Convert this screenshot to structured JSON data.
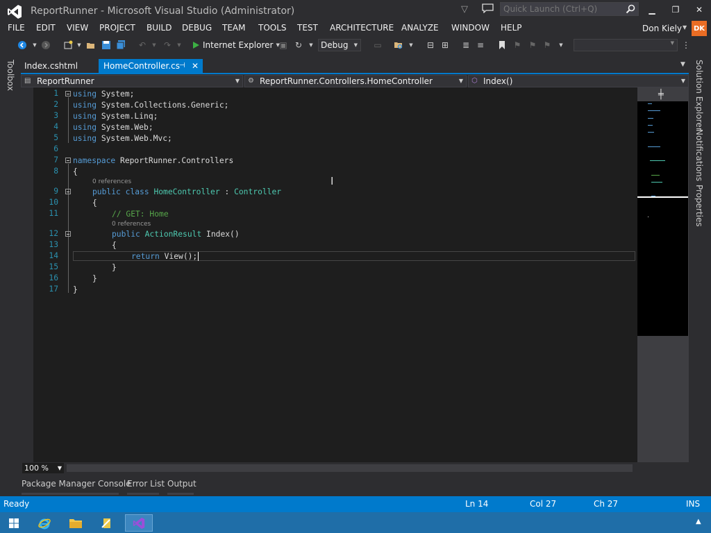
{
  "window": {
    "title": "ReportRunner - Microsoft Visual Studio (Administrator)",
    "quick_launch_placeholder": "Quick Launch (Ctrl+Q)"
  },
  "menu": [
    "FILE",
    "EDIT",
    "VIEW",
    "PROJECT",
    "BUILD",
    "DEBUG",
    "TEAM",
    "TOOLS",
    "TEST",
    "ARCHITECTURE",
    "ANALYZE",
    "WINDOW",
    "HELP"
  ],
  "user": {
    "name": "Don Kiely",
    "initials": "DK",
    "avatar_color": "#ea6d24"
  },
  "toolbar": {
    "run_target": "Internet Explorer",
    "configuration": "Debug",
    "platform": ""
  },
  "side_tabs": {
    "left": "Toolbox",
    "right": [
      "Solution Explorer",
      "Notifications",
      "Properties"
    ]
  },
  "tabs": [
    {
      "label": "Index.cshtml",
      "active": false
    },
    {
      "label": "HomeController.cs",
      "active": true
    }
  ],
  "navbar": {
    "project": "ReportRunner",
    "type": "ReportRunner.Controllers.HomeController",
    "member": "Index()"
  },
  "code": {
    "lines": [
      "1",
      "2",
      "3",
      "4",
      "5",
      "6",
      "7",
      "8",
      "9",
      "10",
      "11",
      "12",
      "13",
      "14",
      "15",
      "16",
      "17"
    ],
    "l1_kw": "using",
    "l1_rest": " System;",
    "l2_kw": "using",
    "l2_rest": " System.Collections.Generic;",
    "l3_kw": "using",
    "l3_rest": " System.Linq;",
    "l4_kw": "using",
    "l4_rest": " System.Web;",
    "l5_kw": "using",
    "l5_rest": " System.Web.Mvc;",
    "l7_kw": "namespace",
    "l7_rest": " ReportRunner.Controllers",
    "l8": "{",
    "lens1": "0 references",
    "l9_a": "public class",
    "l9_b": "HomeController",
    "l9_c": " : ",
    "l9_d": "Controller",
    "l10": "{",
    "l11": "// GET: Home",
    "lens2": "0 references",
    "l12_a": "public",
    "l12_b": "ActionResult",
    "l12_c": " Index()",
    "l13": "{",
    "l14_a": "return",
    "l14_b": " View();",
    "l15": "}",
    "l16": "}",
    "l17": "}"
  },
  "editor": {
    "zoom": "100 %"
  },
  "bottom_tabs": [
    "Package Manager Console",
    "Error List",
    "Output"
  ],
  "status": {
    "state": "Ready",
    "ln": "Ln 14",
    "col": "Col 27",
    "ch": "Ch 27",
    "mode": "INS",
    "bar_color": "#007acc"
  }
}
